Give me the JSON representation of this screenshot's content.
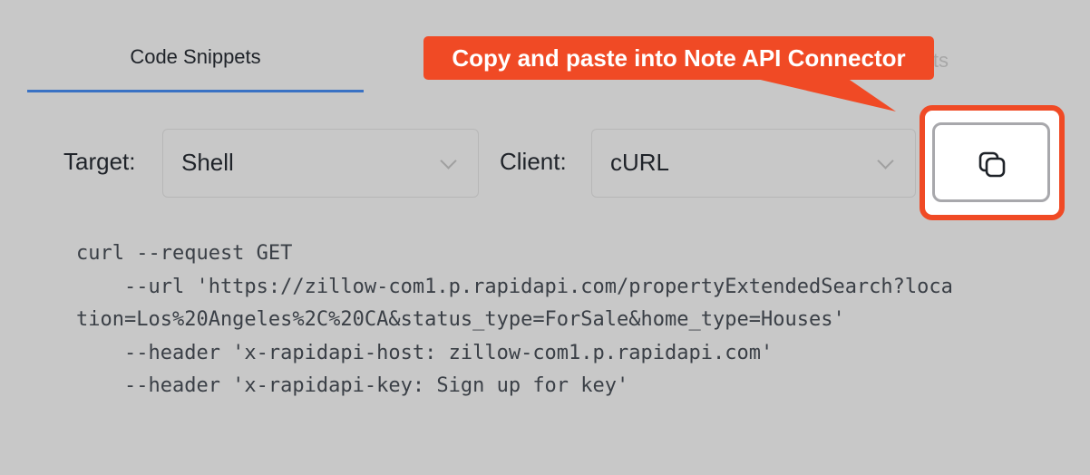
{
  "tabs": [
    {
      "label": "Code Snippets",
      "active": true
    },
    {
      "label": "ts",
      "active": false
    }
  ],
  "target": {
    "label": "Target:",
    "value": "Shell"
  },
  "client": {
    "label": "Client:",
    "value": "cURL"
  },
  "copy_button": {
    "icon": "copy-icon"
  },
  "callout": {
    "text": "Copy and paste into Note API Connector",
    "color": "#f04a25"
  },
  "code": {
    "lines": [
      "curl --request GET",
      "    --url 'https://zillow-com1.p.rapidapi.com/propertyExtendedSearch?loca",
      "tion=Los%20Angeles%2C%20CA&status_type=ForSale&home_type=Houses'",
      "    --header 'x-rapidapi-host: zillow-com1.p.rapidapi.com'",
      "    --header 'x-rapidapi-key: Sign up for key'"
    ]
  },
  "colors": {
    "background": "#c8c8c8",
    "active_tab_underline": "#3a72c4",
    "highlight": "#f04a25"
  }
}
